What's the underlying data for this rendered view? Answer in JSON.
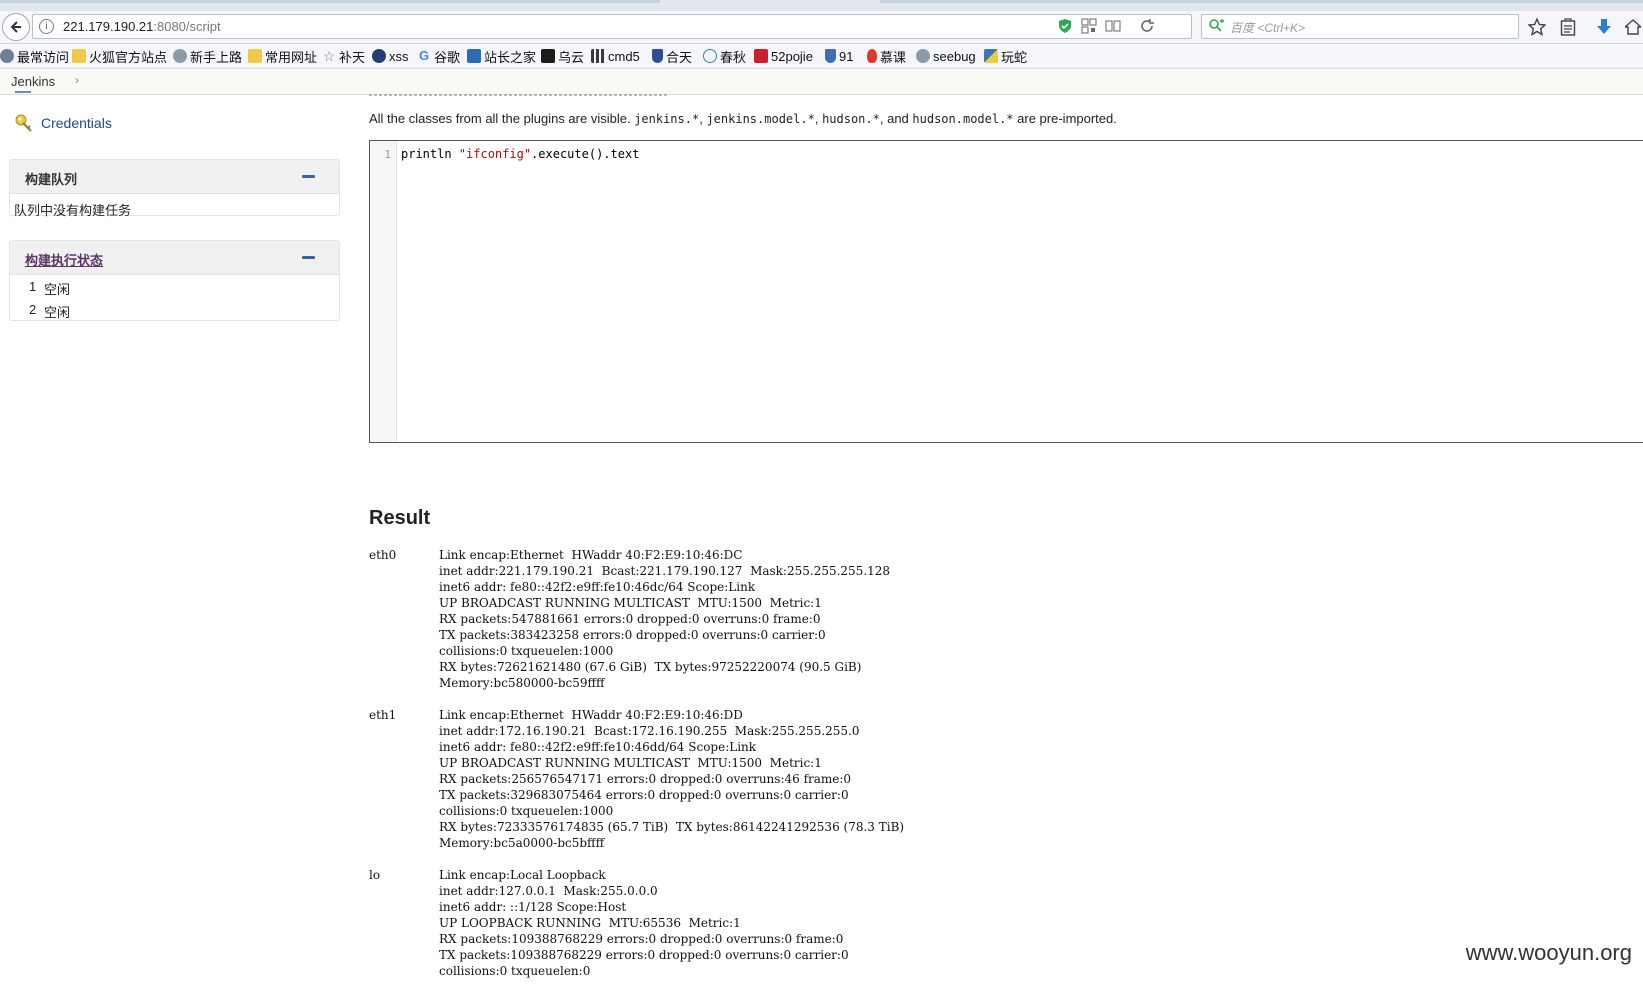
{
  "browser": {
    "url_host": "221.179.190.21",
    "url_path": ":8080/script",
    "search_placeholder": "百度 <Ctrl+K>"
  },
  "bookmarks": [
    {
      "label": "最常访问",
      "icon": "gear-icon",
      "color": "#6f7f95"
    },
    {
      "label": "火狐官方站点",
      "icon": "folder-icon",
      "color": "#f0c94a"
    },
    {
      "label": "新手上路",
      "icon": "globe-icon",
      "color": "#8f9aa8"
    },
    {
      "label": "常用网址",
      "icon": "folder-icon",
      "color": "#f0c94a"
    },
    {
      "label": "补天",
      "icon": "star-icon",
      "color": "#7b8796"
    },
    {
      "label": "xss",
      "icon": "circle-icon",
      "color": "#2a3d73"
    },
    {
      "label": "谷歌",
      "icon": "google-icon",
      "color": "#4285f4"
    },
    {
      "label": "站长之家",
      "icon": "chart-icon",
      "color": "#2f6bb3"
    },
    {
      "label": "乌云",
      "icon": "cloud-icon",
      "color": "#1c1c1c"
    },
    {
      "label": "cmd5",
      "icon": "grid-icon",
      "color": "#3a3a3a"
    },
    {
      "label": "合天",
      "icon": "shield-icon",
      "color": "#2d4f8f"
    },
    {
      "label": "春秋",
      "icon": "i-icon",
      "color": "#3b7fc4"
    },
    {
      "label": "52pojie",
      "icon": "box-icon",
      "color": "#c8232c"
    },
    {
      "label": "91",
      "icon": "shield-icon",
      "color": "#3f6fb0"
    },
    {
      "label": "慕课",
      "icon": "flame-icon",
      "color": "#e0392b"
    },
    {
      "label": "seebug",
      "icon": "globe-icon",
      "color": "#8f9aa8"
    },
    {
      "label": "玩蛇",
      "icon": "python-icon",
      "color": "#3b76b0"
    }
  ],
  "breadcrumb": {
    "item": "Jenkins"
  },
  "sidebar": {
    "credentials_label": "Credentials",
    "build_queue": {
      "title": "构建队列",
      "empty_text": "队列中没有构建任务"
    },
    "executors": {
      "title": "构建执行状态",
      "rows": [
        {
          "num": "1",
          "status": "空闲"
        },
        {
          "num": "2",
          "status": "空闲"
        }
      ]
    }
  },
  "main": {
    "intro": {
      "prefix": "All the classes from all the plugins are visible. ",
      "p1": "jenkins.*",
      "sep1": ", ",
      "p2": "jenkins.model.*",
      "sep2": ", ",
      "p3": "hudson.*",
      "sep3": ", and ",
      "p4": "hudson.model.*",
      "suffix": " are pre-imported."
    },
    "editor": {
      "line_number": "1",
      "code_pre": "println ",
      "code_str": "\"ifconfig\"",
      "code_post": ".execute().text"
    },
    "result_title": "Result",
    "result": [
      {
        "name": "eth0",
        "lines": [
          "Link encap:Ethernet  HWaddr 40:F2:E9:10:46:DC",
          "inet addr:221.179.190.21  Bcast:221.179.190.127  Mask:255.255.255.128",
          "inet6 addr: fe80::42f2:e9ff:fe10:46dc/64 Scope:Link",
          "UP BROADCAST RUNNING MULTICAST  MTU:1500  Metric:1",
          "RX packets:547881661 errors:0 dropped:0 overruns:0 frame:0",
          "TX packets:383423258 errors:0 dropped:0 overruns:0 carrier:0",
          "collisions:0 txqueuelen:1000",
          "RX bytes:72621621480 (67.6 GiB)  TX bytes:97252220074 (90.5 GiB)",
          "Memory:bc580000-bc59ffff"
        ]
      },
      {
        "name": "eth1",
        "lines": [
          "Link encap:Ethernet  HWaddr 40:F2:E9:10:46:DD",
          "inet addr:172.16.190.21  Bcast:172.16.190.255  Mask:255.255.255.0",
          "inet6 addr: fe80::42f2:e9ff:fe10:46dd/64 Scope:Link",
          "UP BROADCAST RUNNING MULTICAST  MTU:1500  Metric:1",
          "RX packets:256576547171 errors:0 dropped:0 overruns:46 frame:0",
          "TX packets:329683075464 errors:0 dropped:0 overruns:0 carrier:0",
          "collisions:0 txqueuelen:1000",
          "RX bytes:72333576174835 (65.7 TiB)  TX bytes:86142241292536 (78.3 TiB)",
          "Memory:bc5a0000-bc5bffff"
        ]
      },
      {
        "name": "lo",
        "lines": [
          "Link encap:Local Loopback",
          "inet addr:127.0.0.1  Mask:255.0.0.0",
          "inet6 addr: ::1/128 Scope:Host",
          "UP LOOPBACK RUNNING  MTU:65536  Metric:1",
          "RX packets:109388768229 errors:0 dropped:0 overruns:0 frame:0",
          "TX packets:109388768229 errors:0 dropped:0 overruns:0 carrier:0",
          "collisions:0 txqueuelen:0"
        ]
      }
    ]
  },
  "watermark": "www.wooyun.org"
}
